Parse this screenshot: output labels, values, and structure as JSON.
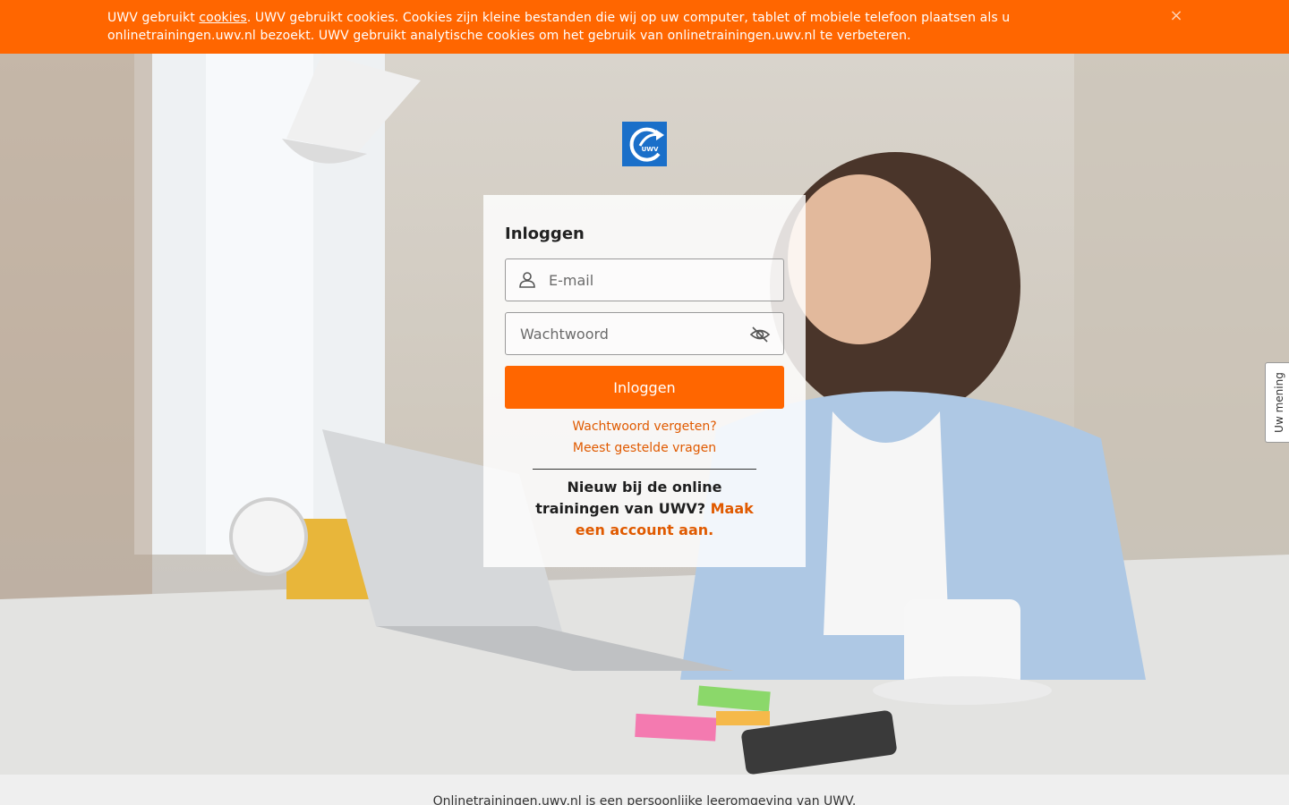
{
  "cookie_banner": {
    "prefix": "UWV gebruikt ",
    "link_label": "cookies",
    "suffix": ". UWV gebruikt cookies. Cookies zijn kleine bestanden die wij op uw computer, tablet of mobiele telefoon plaatsen als u onlinetrainingen.uwv.nl bezoekt. UWV gebruikt analytische cookies om het gebruik van onlinetrainingen.uwv.nl te verbeteren.",
    "close_symbol": "×",
    "background_color": "#ff6600"
  },
  "logo": {
    "text": "UWV",
    "color": "#1a6fc9"
  },
  "login": {
    "title": "Inloggen",
    "email_placeholder": "E-mail",
    "email_value": "",
    "password_placeholder": "Wachtwoord",
    "password_value": "",
    "submit_label": "Inloggen",
    "forgot_password_link": "Wachtwoord vergeten?",
    "faq_link": "Meest gestelde vragen",
    "signup_text": "Nieuw bij de online trainingen van UWV? ",
    "signup_link": "Maak een account aan.",
    "accent_color": "#ff6600",
    "link_color": "#e05a00"
  },
  "feedback_tab": {
    "label": "Uw mening"
  },
  "footer": {
    "text": "Onlinetrainingen.uwv.nl is een persoonlijke leeromgeving van UWV."
  },
  "icons": {
    "email": "user-icon",
    "password_toggle": "eye-slash-icon",
    "close": "close-icon"
  }
}
